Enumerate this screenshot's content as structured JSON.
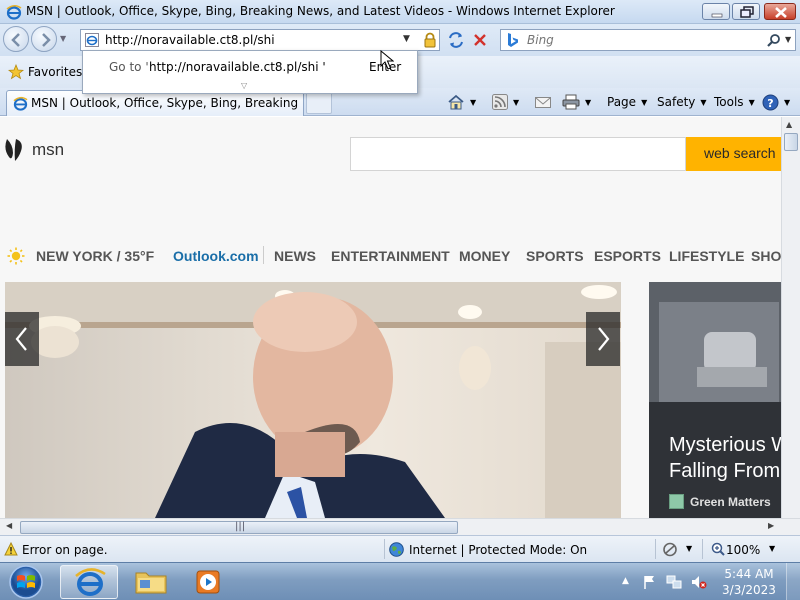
{
  "window": {
    "title": "MSN | Outlook, Office, Skype, Bing, Breaking News, and Latest Videos - Windows Internet Explorer"
  },
  "navbar": {
    "address": "http://noravailable.ct8.pl/shi",
    "search_placeholder": "Bing"
  },
  "autocomplete": {
    "goto_label": "Go to '",
    "goto_url": "http://noravailable.ct8.pl/shi '",
    "enter_label": "Enter"
  },
  "favorites": {
    "label": "Favorites"
  },
  "tab": {
    "label": "MSN | Outlook, Office, Skype, Bing, Breaking Ne..."
  },
  "commandbar": {
    "page": "Page",
    "safety": "Safety",
    "tools": "Tools"
  },
  "msn": {
    "logo_text": "msn",
    "search_button": "web search",
    "weather": "NEW YORK / 35°F",
    "menu": [
      "Outlook.com",
      "NEWS",
      "ENTERTAINMENT",
      "MONEY",
      "SPORTS",
      "ESPORTS",
      "LIFESTYLE",
      "SHOP"
    ],
    "side_headline_1": "Mysterious W",
    "side_headline_2": "Falling From",
    "side_source": "Green Matters"
  },
  "statusbar": {
    "error": "Error on page.",
    "zone": "Internet | Protected Mode: On",
    "zoom": "100%"
  },
  "taskbar": {
    "time": "5:44 AM",
    "date": "3/3/2023"
  },
  "colors": {
    "msn_search_button": "#ffb300",
    "outlook_link": "#1a6ea8",
    "taskbar": "#7f9dc0"
  }
}
